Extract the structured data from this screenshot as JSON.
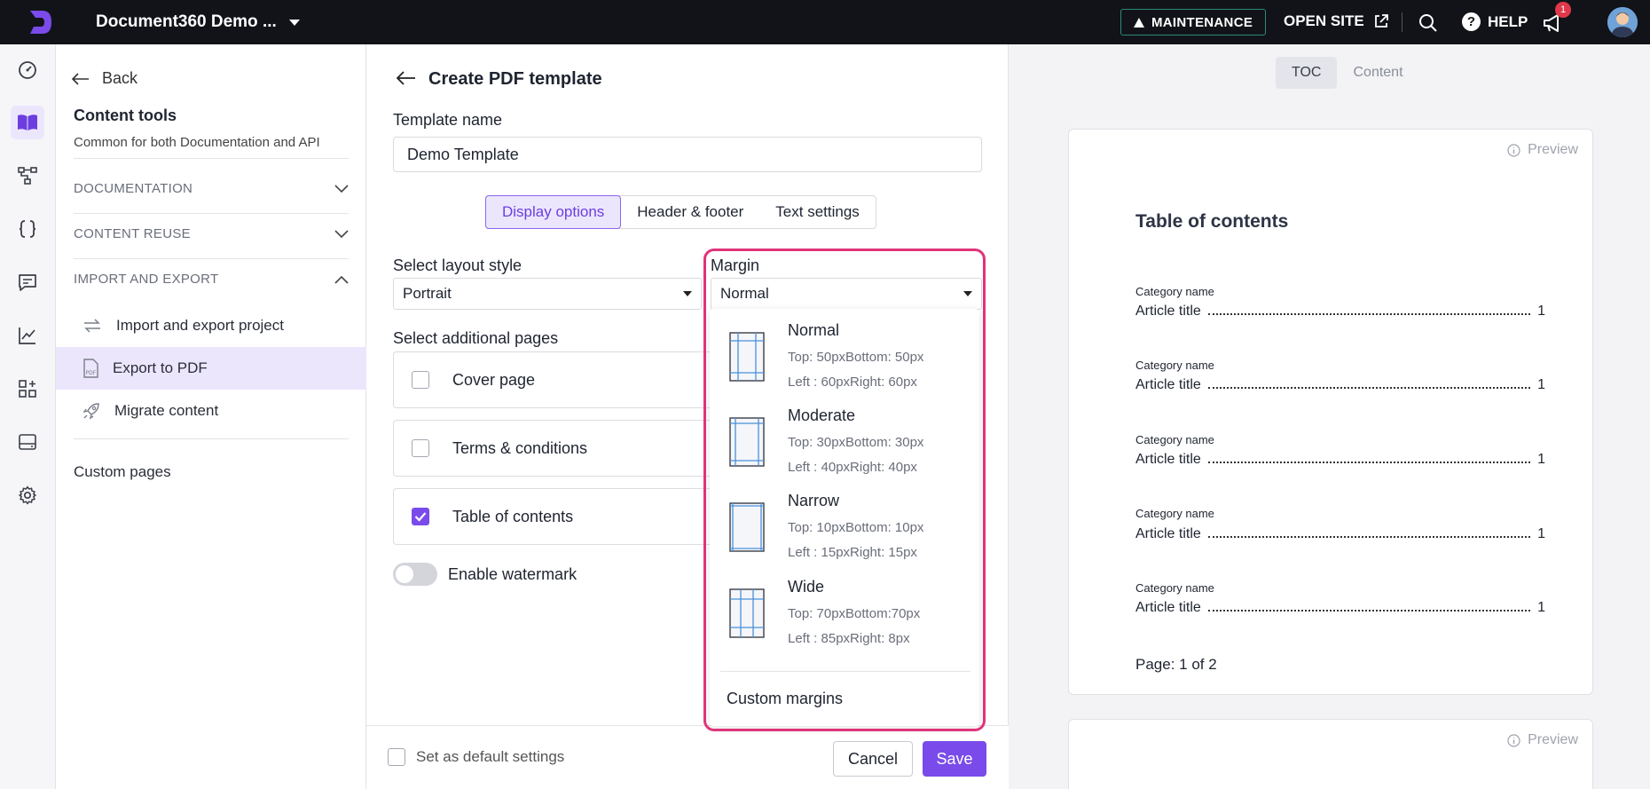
{
  "topbar": {
    "project_name": "Document360 Demo ...",
    "maintenance_label": "MAINTENANCE",
    "open_site_label": "OPEN SITE",
    "help_label": "HELP",
    "notification_count": "1"
  },
  "sidebar": {
    "back_label": "Back",
    "title": "Content tools",
    "subtitle": "Common for both Documentation and API",
    "sections": {
      "documentation": "DOCUMENTATION",
      "content_reuse": "CONTENT REUSE",
      "import_export": "IMPORT AND EXPORT"
    },
    "items": {
      "import_export_project": "Import and export project",
      "export_pdf": "Export to PDF",
      "migrate": "Migrate content"
    },
    "custom_pages": "Custom pages"
  },
  "form": {
    "title": "Create PDF template",
    "template_name_label": "Template name",
    "template_name_value": "Demo Template",
    "tabs": {
      "display": "Display options",
      "header_footer": "Header & footer",
      "text_settings": "Text settings"
    },
    "layout_label": "Select layout style",
    "layout_value": "Portrait",
    "margin_label": "Margin",
    "margin_value": "Normal",
    "additional_pages_label": "Select additional pages",
    "pages": {
      "cover": "Cover page",
      "terms": "Terms & conditions",
      "toc": "Table of contents"
    },
    "watermark_label": "Enable watermark",
    "default_settings_label": "Set as default settings",
    "cancel_label": "Cancel",
    "save_label": "Save"
  },
  "margin_menu": {
    "options": [
      {
        "name": "Normal",
        "line1": "Top: 50pxBottom: 50px",
        "line2": "Left : 60pxRight: 60px"
      },
      {
        "name": "Moderate",
        "line1": "Top: 30pxBottom: 30px",
        "line2": "Left : 40pxRight: 40px"
      },
      {
        "name": "Narrow",
        "line1": "Top: 10pxBottom: 10px",
        "line2": "Left : 15pxRight: 15px"
      },
      {
        "name": "Wide",
        "line1": "Top: 70pxBottom:70px",
        "line2": "Left : 85pxRight: 8px"
      }
    ],
    "custom_label": "Custom margins"
  },
  "preview": {
    "tab_toc": "TOC",
    "tab_content": "Content",
    "preview_label": "Preview",
    "toc_title": "Table of contents",
    "entries": [
      {
        "category": "Category name",
        "article": "Article title",
        "page": "1"
      },
      {
        "category": "Category name",
        "article": "Article title",
        "page": "1"
      },
      {
        "category": "Category name",
        "article": "Article title",
        "page": "1"
      },
      {
        "category": "Category name",
        "article": "Article title",
        "page": "1"
      },
      {
        "category": "Category name",
        "article": "Article title",
        "page": "1"
      }
    ],
    "page_indicator": "Page: 1 of 2"
  },
  "colors": {
    "accent": "#7a4bea",
    "highlight": "#e0337a"
  }
}
